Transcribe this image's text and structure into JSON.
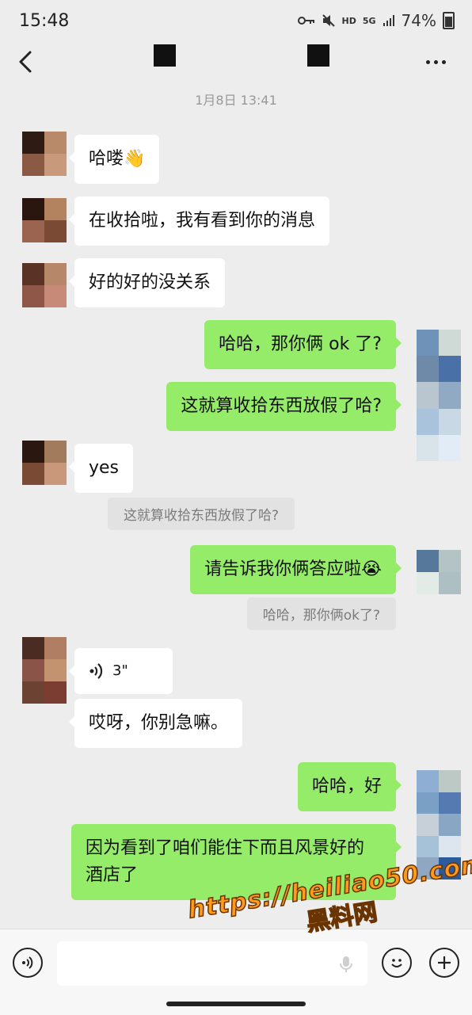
{
  "status_bar": {
    "time": "15:48",
    "network": "HD",
    "signal": "5G",
    "battery": "74%"
  },
  "nav": {
    "back_icon": "chevron-left-icon",
    "more_icon": "more-dots-icon"
  },
  "chat": {
    "timestamp": "1月8日 13:41",
    "messages": [
      {
        "side": "left",
        "text": "哈喽👋"
      },
      {
        "side": "left",
        "text": "在收拾啦，我有看到你的消息"
      },
      {
        "side": "left",
        "text": "好的好的没关系"
      },
      {
        "side": "right",
        "text": "哈哈，那你俩 ok 了?"
      },
      {
        "side": "right",
        "text": "这就算收拾东西放假了哈?"
      },
      {
        "side": "left",
        "text": "yes",
        "quote": "这就算收拾东西放假了哈?"
      },
      {
        "side": "right",
        "text": "请告诉我你俩答应啦😭",
        "quote": "哈哈，那你俩ok了?"
      },
      {
        "side": "left",
        "type": "voice",
        "duration": "3\""
      },
      {
        "side": "left",
        "text": "哎呀，你别急嘛。"
      },
      {
        "side": "right",
        "text": "哈哈，好"
      },
      {
        "side": "right",
        "text": "因为看到了咱们能住下而且风景好的",
        "text_line2": "酒店了"
      }
    ]
  },
  "input_bar": {
    "voice_icon": "voice-toggle-icon",
    "emoji_icon": "emoji-icon",
    "add_icon": "plus-icon",
    "placeholder": ""
  },
  "watermark": {
    "url": "https://heiliao50.com",
    "name": "黑料网"
  }
}
